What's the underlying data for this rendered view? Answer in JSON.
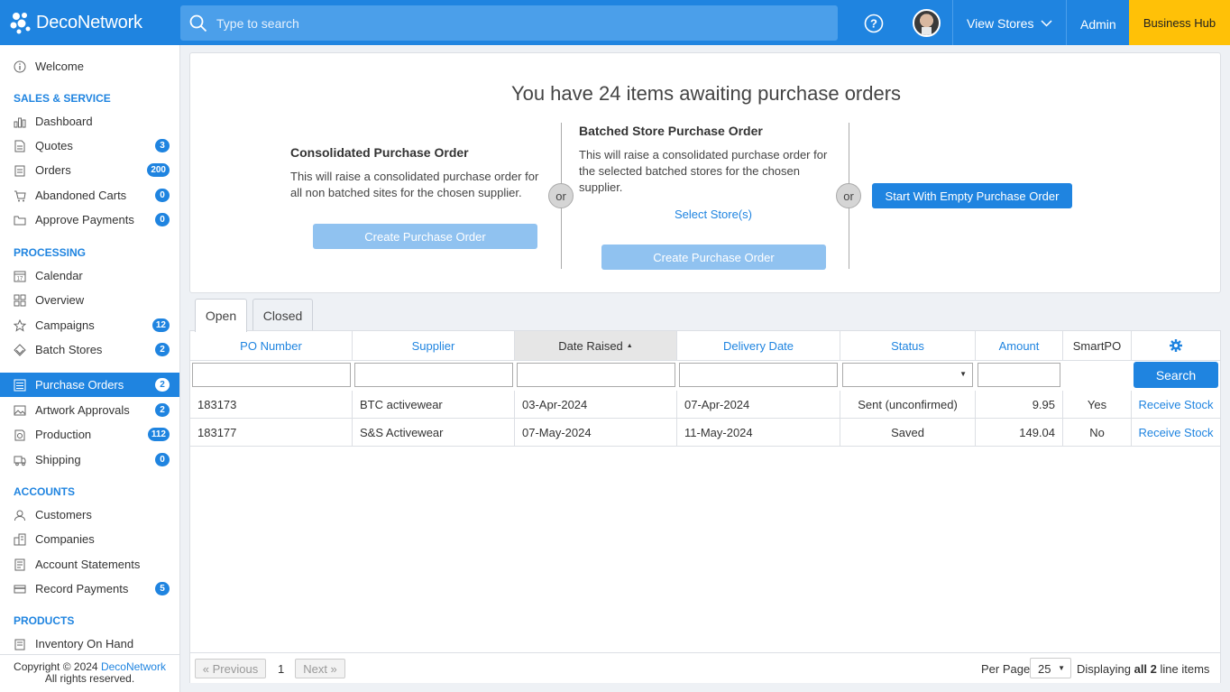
{
  "topbar": {
    "logo_text": "DecoNetwork",
    "search_placeholder": "Type to search",
    "view_stores": "View Stores",
    "admin": "Admin",
    "business_hub": "Business Hub"
  },
  "sidebar": {
    "welcome": "Welcome",
    "sections": {
      "sales": "SALES & SERVICE",
      "processing": "PROCESSING",
      "accounts": "ACCOUNTS",
      "products": "PRODUCTS"
    },
    "items": [
      {
        "label": "Dashboard",
        "icon": "bar-chart-icon"
      },
      {
        "label": "Quotes",
        "badge": "3",
        "icon": "document-icon"
      },
      {
        "label": "Orders",
        "badge": "200",
        "icon": "clipboard-icon"
      },
      {
        "label": "Abandoned Carts",
        "badge": "0",
        "icon": "cart-icon"
      },
      {
        "label": "Approve Payments",
        "badge": "0",
        "icon": "folder-icon"
      },
      {
        "label": "Calendar",
        "icon": "calendar-icon"
      },
      {
        "label": "Overview",
        "icon": "grid-icon"
      },
      {
        "label": "Campaigns",
        "badge": "12",
        "icon": "star-icon"
      },
      {
        "label": "Batch Stores",
        "badge": "2",
        "icon": "layers-icon"
      },
      {
        "label": "Purchase Orders",
        "badge": "2",
        "icon": "list-icon"
      },
      {
        "label": "Artwork Approvals",
        "badge": "2",
        "icon": "image-icon"
      },
      {
        "label": "Production",
        "badge": "112",
        "icon": "factory-icon"
      },
      {
        "label": "Shipping",
        "badge": "0",
        "icon": "truck-icon"
      },
      {
        "label": "Customers",
        "icon": "user-icon"
      },
      {
        "label": "Companies",
        "icon": "building-icon"
      },
      {
        "label": "Account Statements",
        "icon": "statement-icon"
      },
      {
        "label": "Record Payments",
        "badge": "5",
        "icon": "card-icon"
      },
      {
        "label": "Inventory On Hand",
        "icon": "inventory-icon"
      }
    ],
    "copyright_prefix": "Copyright © 2024 ",
    "copyright_link": "DecoNetwork",
    "rights": "All rights reserved."
  },
  "summary": {
    "headline": "You have 24 items awaiting purchase orders",
    "consolidated_title": "Consolidated Purchase Order",
    "consolidated_text": "This will raise a consolidated purchase order for all non batched sites for the chosen supplier.",
    "create_button": "Create Purchase Order",
    "or": "or",
    "batched_title": "Batched Store Purchase Order",
    "batched_text": "This will raise a consolidated purchase order for the selected batched stores for the chosen supplier.",
    "select_stores": "Select Store(s)",
    "empty_button": "Start With Empty Purchase Order"
  },
  "tabs": [
    "Open",
    "Closed"
  ],
  "grid": {
    "columns": [
      "PO Number",
      "Supplier",
      "Date Raised",
      "Delivery Date",
      "Status",
      "Amount",
      "SmartPO"
    ],
    "search_button": "Search",
    "rows": [
      {
        "po": "183173",
        "supplier": "BTC activewear",
        "raised": "03-Apr-2024",
        "delivery": "07-Apr-2024",
        "status": "Sent (unconfirmed)",
        "amount": "9.95",
        "smartpo": "Yes",
        "action": "Receive Stock"
      },
      {
        "po": "183177",
        "supplier": "S&S Activewear",
        "raised": "07-May-2024",
        "delivery": "11-May-2024",
        "status": "Saved",
        "amount": "149.04",
        "smartpo": "No",
        "action": "Receive Stock"
      }
    ],
    "pager": {
      "previous": "« Previous",
      "page": "1",
      "next": "Next »",
      "per_page_label": "Per Page",
      "per_page": "25",
      "display_prefix": "Displaying ",
      "display_bold": "all 2",
      "display_suffix": " line items"
    }
  },
  "colors": {
    "primary": "#1f84e0",
    "business_hub": "#ffc107"
  }
}
